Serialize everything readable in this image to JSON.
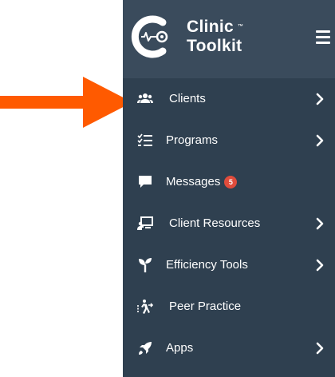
{
  "brand": {
    "line1": "Clinic",
    "line2": "Toolkit",
    "trademark": "™"
  },
  "colors": {
    "sidebar_bg": "#2f4050",
    "header_bg": "#3a4b5c",
    "arrow": "#ff5a00",
    "badge": "#e04c3c"
  },
  "menu": [
    {
      "label": "Clients",
      "icon": "users-icon",
      "chevron": true
    },
    {
      "label": "Programs",
      "icon": "checklist-icon",
      "chevron": true
    },
    {
      "label": "Messages",
      "icon": "chat-icon",
      "chevron": false,
      "badge": "5"
    },
    {
      "label": "Client Resources",
      "icon": "presentation-icon",
      "chevron": true
    },
    {
      "label": "Efficiency Tools",
      "icon": "seedling-icon",
      "chevron": true
    },
    {
      "label": "Peer Practice",
      "icon": "running-person-icon",
      "chevron": false
    },
    {
      "label": "Apps",
      "icon": "rocket-icon",
      "chevron": true
    }
  ]
}
